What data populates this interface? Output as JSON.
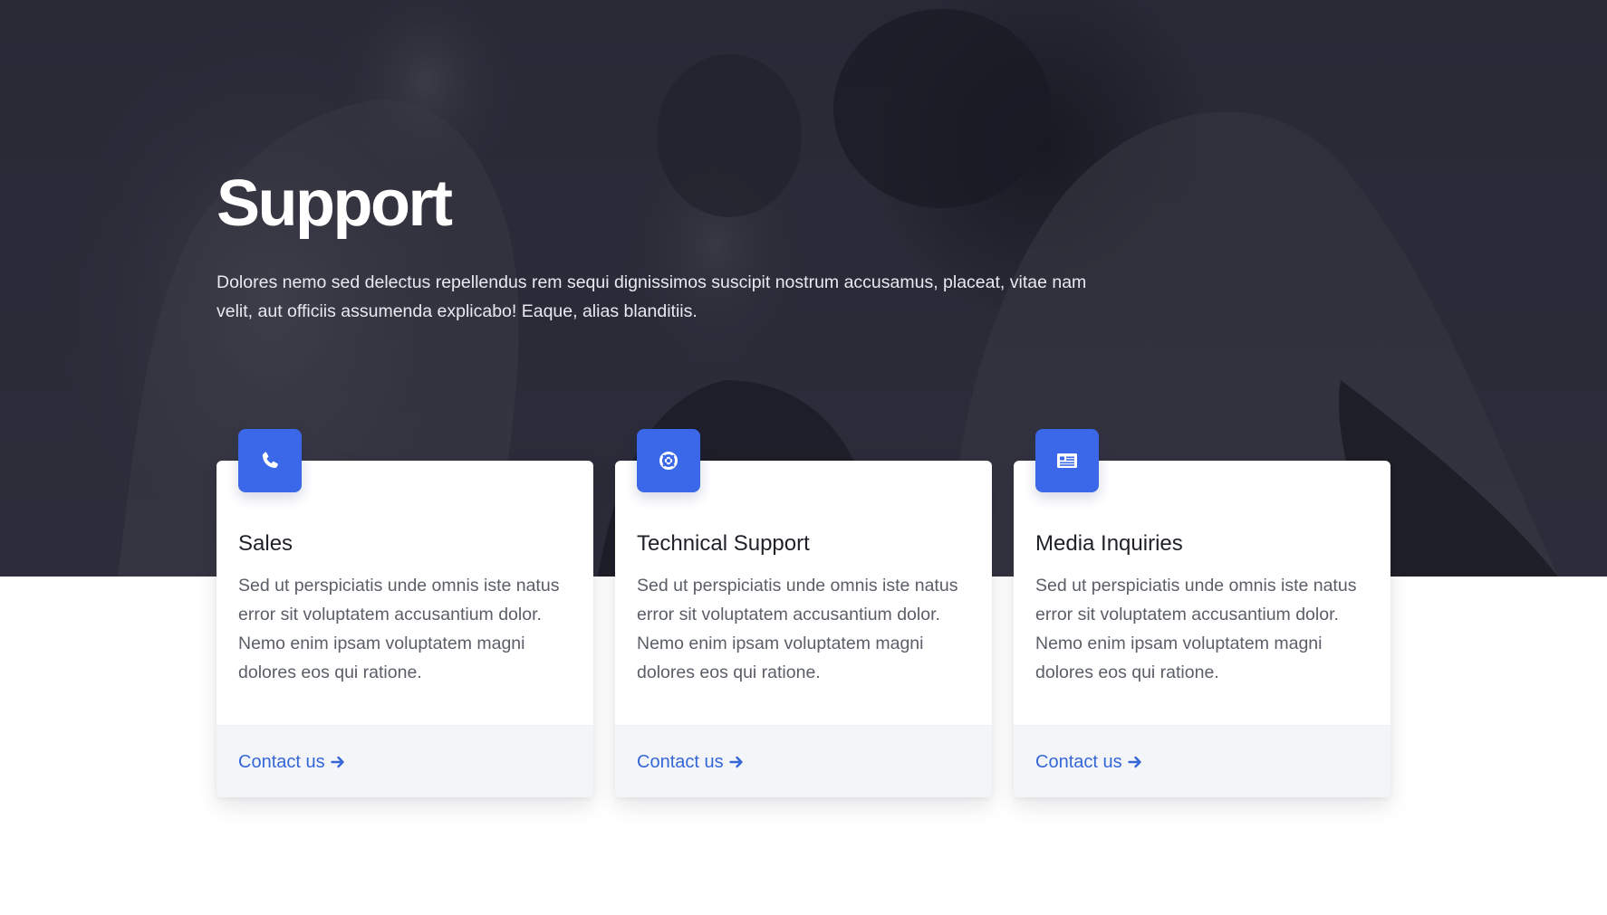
{
  "hero": {
    "title": "Support",
    "lead": "Dolores nemo sed delectus repellendus rem sequi dignissimos suscipit nostrum accusamus, placeat, vitae nam velit, aut officiis assumenda explicabo! Eaque, alias blanditiis."
  },
  "cards": [
    {
      "icon": "phone-icon",
      "title": "Sales",
      "text": "Sed ut perspiciatis unde omnis iste natus error sit voluptatem accusantium dolor. Nemo enim ipsam voluptatem magni dolores eos qui ratione.",
      "link": "Contact us"
    },
    {
      "icon": "life-ring-icon",
      "title": "Technical Support",
      "text": "Sed ut perspiciatis unde omnis iste natus error sit voluptatem accusantium dolor. Nemo enim ipsam voluptatem magni dolores eos qui ratione.",
      "link": "Contact us"
    },
    {
      "icon": "newspaper-icon",
      "title": "Media Inquiries",
      "text": "Sed ut perspiciatis unde omnis iste natus error sit voluptatem accusantium dolor. Nemo enim ipsam voluptatem magni dolores eos qui ratione.",
      "link": "Contact us"
    }
  ],
  "colors": {
    "accent": "#3b68e8",
    "link": "#3466d8",
    "hero_bg": "#2d2d3b"
  }
}
